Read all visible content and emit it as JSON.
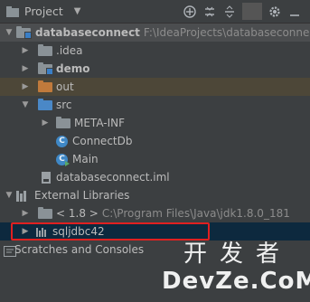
{
  "header": {
    "title": "Project",
    "caret": "▼",
    "icons": [
      "add-icon",
      "collapse-all-icon",
      "expand-icon",
      "settings-icon",
      "hide-icon"
    ]
  },
  "tree": {
    "root": {
      "name": "databaseconnect",
      "path": "F:\\IdeaProjects\\databaseconnect"
    },
    "idea": ".idea",
    "demo": "demo",
    "out": "out",
    "src": "src",
    "meta_inf": "META-INF",
    "connectdb": "ConnectDb",
    "main": "Main",
    "iml": "databaseconnect.iml",
    "external_libraries": "External Libraries",
    "jdk": {
      "name": "< 1.8 >",
      "path": "C:\\Program Files\\Java\\jdk1.8.0_181"
    },
    "sqljdbc": "sqljdbc42",
    "scratches": "Scratches and Consoles"
  },
  "watermark": {
    "cn": "开发者",
    "en": "DevZe.CoM"
  },
  "colors": {
    "background": "#3c3f41",
    "selection": "#0d293e",
    "highlight": "#e02020"
  }
}
